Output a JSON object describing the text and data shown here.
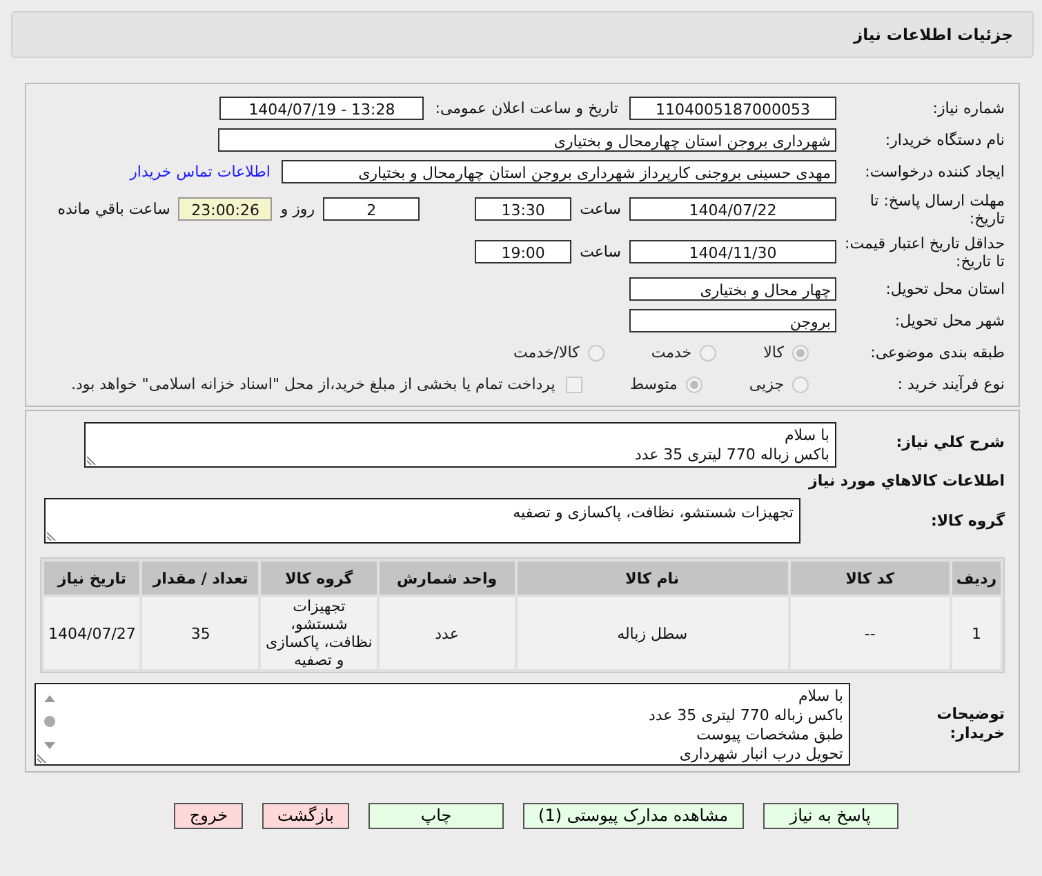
{
  "title": "جزئیات اطلاعات نیاز",
  "need_number": {
    "label": "شماره نیاز:",
    "value": "1104005187000053"
  },
  "announce": {
    "label": "تاریخ و ساعت اعلان عمومی:",
    "value": "1404/07/19 - 13:28"
  },
  "buyer": {
    "label": "نام دستگاه خریدار:",
    "value": "شهرداری بروجن استان چهارمحال و بختیاری"
  },
  "creator": {
    "label": "ایجاد کننده درخواست:",
    "value": "مهدی حسینی بروجنی کارپرداز شهرداری بروجن استان چهارمحال و بختیاری",
    "link": "اطلاعات تماس خریدار"
  },
  "deadline": {
    "label": "مهلت ارسال پاسخ: تا تاریخ:",
    "date": "1404/07/22",
    "time_label": "ساعت",
    "time": "13:30",
    "days": "2",
    "days_label": "روز و",
    "remaining": "23:00:26",
    "remaining_label": "ساعت باقي مانده"
  },
  "validity": {
    "label": "حداقل تاریخ اعتبار قیمت: تا تاریخ:",
    "date": "1404/11/30",
    "time_label": "ساعت",
    "time": "19:00"
  },
  "province": {
    "label": "استان محل تحویل:",
    "value": "چهار محال و بختیاری"
  },
  "city": {
    "label": "شهر محل تحویل:",
    "value": "بروجن"
  },
  "category": {
    "label": "طبقه بندی موضوعی:",
    "options": [
      {
        "label": "کالا",
        "selected": true
      },
      {
        "label": "خدمت",
        "selected": false
      },
      {
        "label": "کالا/خدمت",
        "selected": false
      }
    ]
  },
  "process": {
    "label": "نوع فرآیند خرید :",
    "options": [
      {
        "label": "جزیی",
        "selected": false
      },
      {
        "label": "متوسط",
        "selected": true
      }
    ],
    "payment": {
      "label": "پرداخت تمام یا بخشی از مبلغ خرید،از محل \"اسناد خزانه اسلامی\" خواهد بود.",
      "checked": false
    }
  },
  "description": {
    "label": "شرح کلي نياز:",
    "lines": [
      "با سلام",
      "باکس زباله 770 لیتری  35 عدد"
    ]
  },
  "goods_title": "اطلاعات کالاهاي مورد نياز",
  "goods_group": {
    "label": "گروه کالا:",
    "value": "تجهیزات شستشو، نظافت، پاکسازی و تصفیه"
  },
  "table": {
    "columns": [
      "ردیف",
      "کد کالا",
      "نام کالا",
      "واحد شمارش",
      "گروه کالا",
      "تعداد / مقدار",
      "تاریخ نیاز"
    ],
    "rows": [
      [
        "1",
        "--",
        "سطل زباله",
        "عدد",
        "تجهیزات شستشو، نظافت، پاکسازی و تصفیه",
        "35",
        "1404/07/27"
      ]
    ]
  },
  "buyer_notes": {
    "label": "توضیحات خریدار:",
    "lines": [
      "با سلام",
      "باکس زباله 770 لیتری  35 عدد",
      "طبق مشخصات پیوست",
      "تحویل درب انبار شهرداری"
    ]
  },
  "buttons": [
    {
      "label": "پاسخ به نیاز",
      "kind": "normal"
    },
    {
      "label": "مشاهده مدارک پیوستی (1)",
      "kind": "normal"
    },
    {
      "label": "چاپ",
      "kind": "normal"
    },
    {
      "label": "بازگشت",
      "kind": "danger"
    },
    {
      "label": "خروج",
      "kind": "danger"
    }
  ]
}
